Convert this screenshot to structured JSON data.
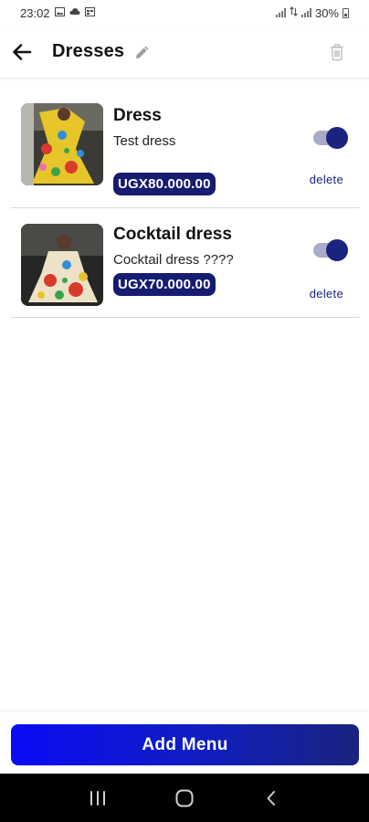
{
  "status_bar": {
    "time": "23:02",
    "battery_text": "30%"
  },
  "header": {
    "title": "Dresses"
  },
  "items": [
    {
      "name": "Dress",
      "description": "Test dress",
      "price": "UGX80.000.00",
      "enabled": true,
      "delete_label": "delete"
    },
    {
      "name": "Cocktail dress",
      "description": "Cocktail dress ????",
      "price": "UGX70.000.00",
      "enabled": true,
      "delete_label": "delete"
    }
  ],
  "footer": {
    "add_menu_label": "Add Menu"
  },
  "colors": {
    "accent": "#1a237e",
    "button_start": "#0a0cf5",
    "badge": "#161c70"
  },
  "icons": {
    "back": "arrow-left-icon",
    "edit": "pencil-icon",
    "trash": "trash-icon",
    "nav_recent": "recent-apps-icon",
    "nav_home": "home-icon",
    "nav_back": "chevron-left-icon"
  }
}
